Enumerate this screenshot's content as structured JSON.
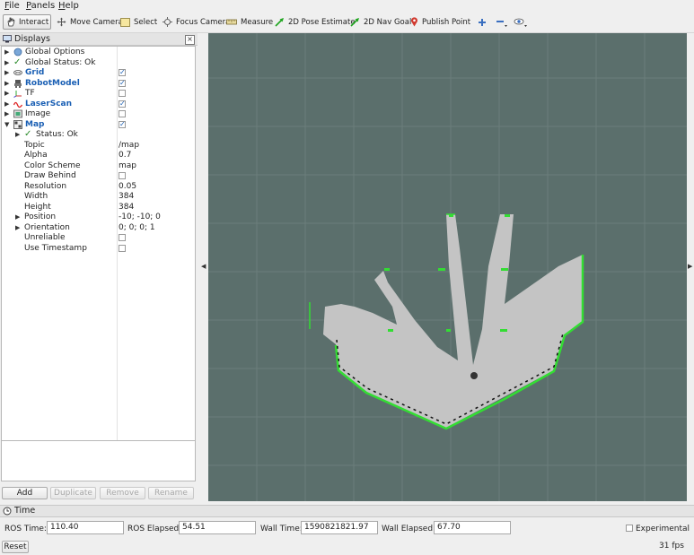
{
  "menu": {
    "file": "File",
    "panels": "Panels",
    "help": "Help"
  },
  "toolbar": {
    "interact": "Interact",
    "move_camera": "Move Camera",
    "select": "Select",
    "focus_camera": "Focus Camera",
    "measure": "Measure",
    "pose_estimate": "2D Pose Estimate",
    "nav_goal": "2D Nav Goal",
    "publish_point": "Publish Point"
  },
  "displays": {
    "title": "Displays",
    "rows": [
      {
        "label": "Global Options",
        "value": ""
      },
      {
        "label": "Global Status: Ok",
        "value": ""
      },
      {
        "label": "Grid",
        "value": "",
        "checked": true
      },
      {
        "label": "RobotModel",
        "value": "",
        "checked": true
      },
      {
        "label": "TF",
        "value": "",
        "checked": false
      },
      {
        "label": "LaserScan",
        "value": "",
        "checked": true
      },
      {
        "label": "Image",
        "value": "",
        "checked": false
      },
      {
        "label": "Map",
        "value": "",
        "checked": true
      },
      {
        "label": "Status: Ok",
        "value": ""
      },
      {
        "label": "Topic",
        "value": "/map"
      },
      {
        "label": "Alpha",
        "value": "0.7"
      },
      {
        "label": "Color Scheme",
        "value": "map"
      },
      {
        "label": "Draw Behind",
        "value": "",
        "checked": false
      },
      {
        "label": "Resolution",
        "value": "0.05"
      },
      {
        "label": "Width",
        "value": "384"
      },
      {
        "label": "Height",
        "value": "384"
      },
      {
        "label": "Position",
        "value": "-10; -10; 0"
      },
      {
        "label": "Orientation",
        "value": "0; 0; 0; 1"
      },
      {
        "label": "Unreliable",
        "value": "",
        "checked": false
      },
      {
        "label": "Use Timestamp",
        "value": "",
        "checked": false
      }
    ],
    "buttons": {
      "add": "Add",
      "duplicate": "Duplicate",
      "remove": "Remove",
      "rename": "Rename"
    }
  },
  "time": {
    "title": "Time",
    "ros_time_label": "ROS Time:",
    "ros_time": "110.40",
    "ros_elapsed_label": "ROS Elapsed:",
    "ros_elapsed": "54.51",
    "wall_time_label": "Wall Time:",
    "wall_time": "1590821821.97",
    "wall_elapsed_label": "Wall Elapsed:",
    "wall_elapsed": "67.70",
    "experimental_label": "Experimental",
    "reset": "Reset",
    "fps": "31 fps"
  },
  "colors": {
    "view_background": "#5b6f6c",
    "map_free": "#c4c4c4",
    "laser": "#33dd33",
    "display_link": "#1a5fb4"
  }
}
